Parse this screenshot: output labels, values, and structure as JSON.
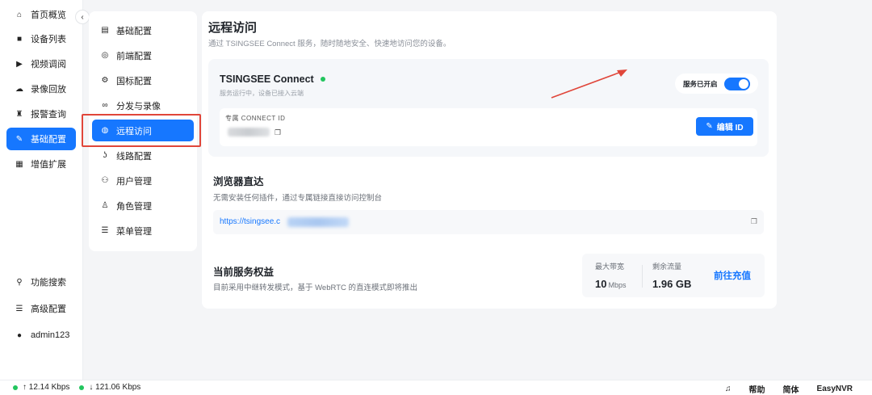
{
  "left_nav": {
    "items": [
      {
        "label": "首页概览",
        "icon": "home-icon"
      },
      {
        "label": "设备列表",
        "icon": "camera-icon"
      },
      {
        "label": "视频调阅",
        "icon": "play-icon"
      },
      {
        "label": "录像回放",
        "icon": "cloud-icon"
      },
      {
        "label": "报警查询",
        "icon": "alarm-icon"
      },
      {
        "label": "基础配置",
        "icon": "edit-icon",
        "active": true
      },
      {
        "label": "增值扩展",
        "icon": "grid-icon"
      }
    ],
    "bottom": [
      {
        "label": "功能搜索",
        "icon": "search-icon"
      },
      {
        "label": "高级配置",
        "icon": "menu-icon"
      },
      {
        "label": "admin123",
        "icon": "user-icon"
      }
    ],
    "collapse": "‹"
  },
  "sub_nav": {
    "items": [
      {
        "label": "基础配置",
        "icon": "file-icon"
      },
      {
        "label": "前端配置",
        "icon": "chrome-icon"
      },
      {
        "label": "国标配置",
        "icon": "gear-icon"
      },
      {
        "label": "分发与录像",
        "icon": "link-icon"
      },
      {
        "label": "远程访问",
        "icon": "globe-icon",
        "active": true
      },
      {
        "label": "线路配置",
        "icon": "route-icon"
      },
      {
        "label": "用户管理",
        "icon": "users-icon"
      },
      {
        "label": "角色管理",
        "icon": "role-icon"
      },
      {
        "label": "菜单管理",
        "icon": "list-icon"
      }
    ]
  },
  "main": {
    "title": "远程访问",
    "subtitle": "通过 TSINGSEE Connect 服务，随时随地安全、快速地访问您的设备。",
    "connect": {
      "title": "TSINGSEE Connect",
      "status": "服务运行中，设备已接入云端",
      "service_label": "服务已开启",
      "service_on": true,
      "id_label": "专属 CONNECT ID",
      "edit_label": "编辑 ID"
    },
    "browser": {
      "title": "浏览器直达",
      "subtitle": "无需安装任何插件，通过专属链接直接访问控制台",
      "url": "https://tsingsee.c"
    },
    "rights": {
      "title": "当前服务权益",
      "subtitle": "目前采用中继转发模式，基于 WebRTC 的直连模式即将推出",
      "bandwidth_label": "最大带宽",
      "bandwidth_value": "10",
      "bandwidth_unit": "Mbps",
      "traffic_label": "剩余流量",
      "traffic_value": "1.96 GB",
      "recharge_label": "前往充值"
    }
  },
  "status_bar": {
    "upload": "↑ 12.14 Kbps",
    "download": "↓ 121.06 Kbps",
    "help": "帮助",
    "lang": "简体",
    "app": "EasyNVR"
  },
  "colors": {
    "accent": "#1677ff",
    "online": "#22c55e",
    "highlight_box": "#e0463a"
  }
}
